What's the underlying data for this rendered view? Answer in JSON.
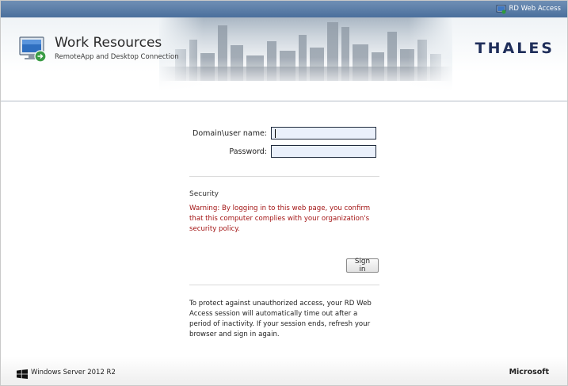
{
  "header": {
    "link_label": "RD Web Access",
    "app_title": "Work Resources",
    "app_subtitle": "RemoteApp and Desktop Connection",
    "company_logo": "THALES"
  },
  "form": {
    "username_label": "Domain\\user name:",
    "username_value": "",
    "password_label": "Password:",
    "password_value": ""
  },
  "security": {
    "heading": "Security",
    "warning": "Warning: By logging in to this web page, you confirm that this computer complies with your organization's security policy."
  },
  "actions": {
    "signin_label": "Sign in"
  },
  "timeout_notice": "To protect against unauthorized access, your RD Web Access session will automatically time out after a period of inactivity. If your session ends, refresh your browser and sign in again.",
  "footer": {
    "os_label": "Windows Server 2012 R2",
    "vendor_label": "Microsoft"
  },
  "colors": {
    "topbar": "#4a6f9c",
    "warning_text": "#a31515",
    "input_bg": "#eaf0fb",
    "logo": "#1f2e5a"
  }
}
